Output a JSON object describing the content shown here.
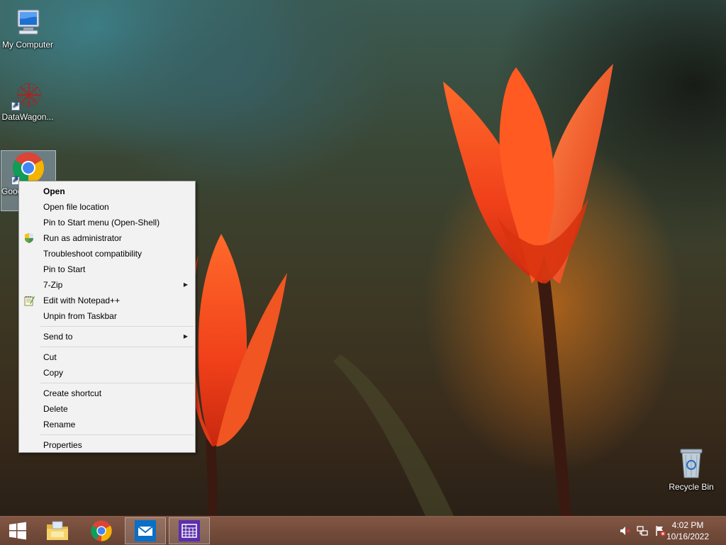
{
  "desktop": {
    "icons": [
      {
        "label": "My Computer",
        "icon": "computer-icon"
      },
      {
        "label": "DataWagon...",
        "icon": "datawagon-icon"
      },
      {
        "label": "Google Chrome",
        "icon": "chrome-icon",
        "selected": true
      },
      {
        "label": "Recycle Bin",
        "icon": "recycle-bin-icon"
      }
    ]
  },
  "context_menu": {
    "groups": [
      [
        {
          "label": "Open",
          "bold": true
        },
        {
          "label": "Open file location"
        },
        {
          "label": "Pin to Start menu (Open-Shell)"
        },
        {
          "label": "Run as administrator",
          "icon": "uac-shield-icon"
        },
        {
          "label": "Troubleshoot compatibility"
        },
        {
          "label": "Pin to Start"
        },
        {
          "label": "7-Zip",
          "submenu": true
        },
        {
          "label": "Edit with Notepad++",
          "icon": "notepadpp-icon"
        },
        {
          "label": "Unpin from Taskbar"
        }
      ],
      [
        {
          "label": "Send to",
          "submenu": true
        }
      ],
      [
        {
          "label": "Cut"
        },
        {
          "label": "Copy"
        }
      ],
      [
        {
          "label": "Create shortcut"
        },
        {
          "label": "Delete"
        },
        {
          "label": "Rename"
        }
      ],
      [
        {
          "label": "Properties"
        }
      ]
    ]
  },
  "taskbar": {
    "start_icon": "windows-start-icon",
    "pinned": [
      {
        "name": "file-explorer",
        "icon": "folder-icon"
      },
      {
        "name": "chrome",
        "icon": "chrome-icon"
      },
      {
        "name": "mail",
        "icon": "mail-icon",
        "active": true
      },
      {
        "name": "calendar",
        "icon": "calendar-icon",
        "active": true
      }
    ],
    "tray": [
      {
        "name": "volume-muted",
        "icon": "speaker-muted-icon"
      },
      {
        "name": "network",
        "icon": "network-icon"
      },
      {
        "name": "action-center",
        "icon": "flag-alert-icon"
      }
    ],
    "clock": {
      "time": "4:02 PM",
      "date": "10/16/2022"
    }
  },
  "colors": {
    "taskbar": "#6a4030",
    "menu_bg": "#f2f2f2",
    "chrome_red": "#db4437",
    "chrome_green": "#0f9d58",
    "chrome_yellow": "#f4b400",
    "chrome_blue": "#4285f4"
  }
}
